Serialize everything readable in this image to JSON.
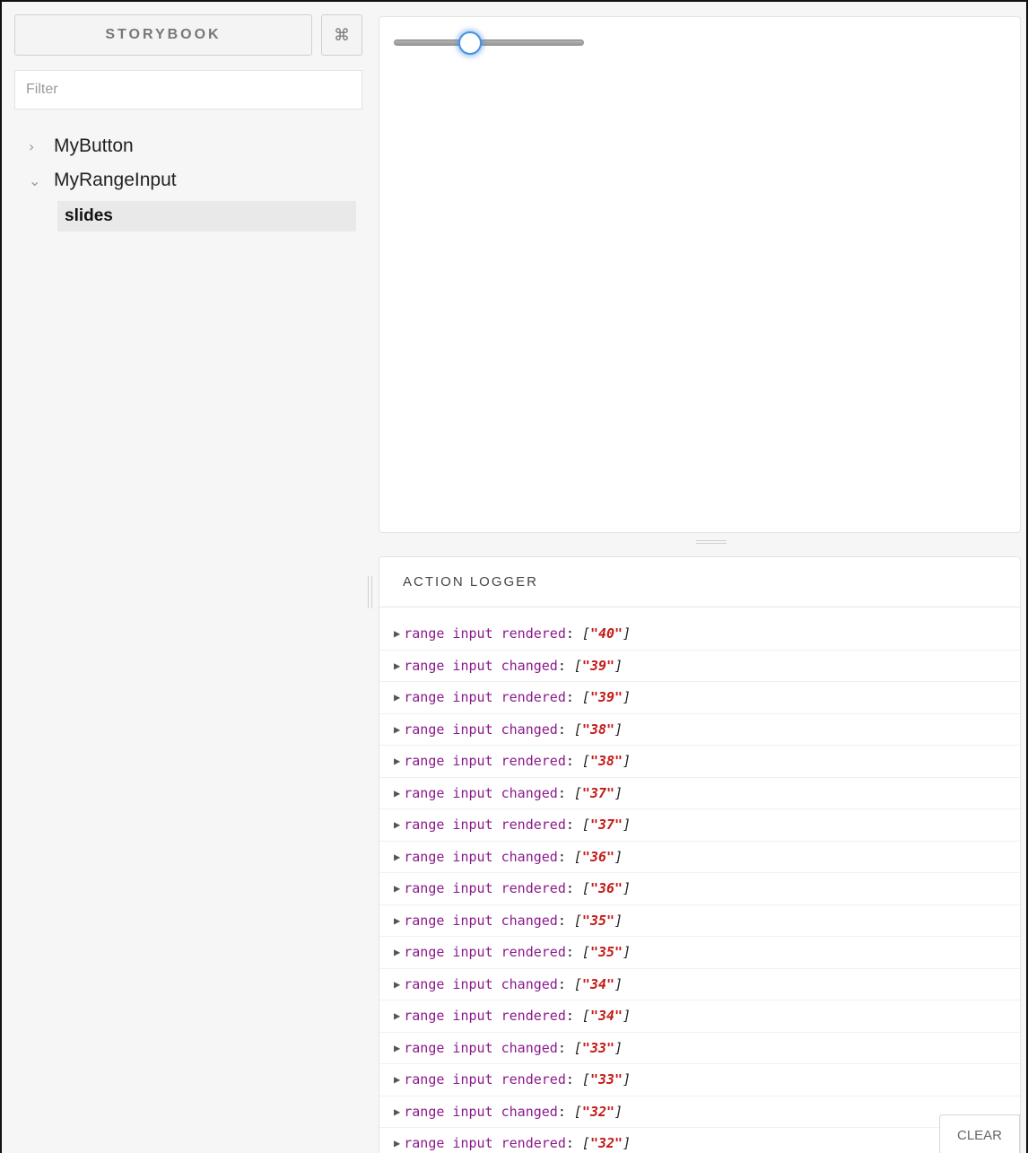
{
  "sidebar": {
    "brand_label": "STORYBOOK",
    "shortcut_label": "⌘",
    "filter_placeholder": "Filter",
    "kinds": [
      {
        "label": "MyButton",
        "expanded": false,
        "chevron": "›"
      },
      {
        "label": "MyRangeInput",
        "expanded": true,
        "chevron": "⌄"
      }
    ],
    "selected_story": "slides"
  },
  "preview": {
    "slider": {
      "value": 40,
      "min": 0,
      "max": 100
    }
  },
  "action_logger": {
    "tab_label": "ACTION LOGGER",
    "clear_label": "CLEAR",
    "entries": [
      {
        "name": "range input rendered",
        "value": "40"
      },
      {
        "name": "range input changed",
        "value": "39"
      },
      {
        "name": "range input rendered",
        "value": "39"
      },
      {
        "name": "range input changed",
        "value": "38"
      },
      {
        "name": "range input rendered",
        "value": "38"
      },
      {
        "name": "range input changed",
        "value": "37"
      },
      {
        "name": "range input rendered",
        "value": "37"
      },
      {
        "name": "range input changed",
        "value": "36"
      },
      {
        "name": "range input rendered",
        "value": "36"
      },
      {
        "name": "range input changed",
        "value": "35"
      },
      {
        "name": "range input rendered",
        "value": "35"
      },
      {
        "name": "range input changed",
        "value": "34"
      },
      {
        "name": "range input rendered",
        "value": "34"
      },
      {
        "name": "range input changed",
        "value": "33"
      },
      {
        "name": "range input rendered",
        "value": "33"
      },
      {
        "name": "range input changed",
        "value": "32"
      },
      {
        "name": "range input rendered",
        "value": "32"
      }
    ]
  },
  "colors": {
    "accent": "#4a90e2",
    "log_name": "#8a1a8a",
    "log_value": "#c41a16"
  }
}
